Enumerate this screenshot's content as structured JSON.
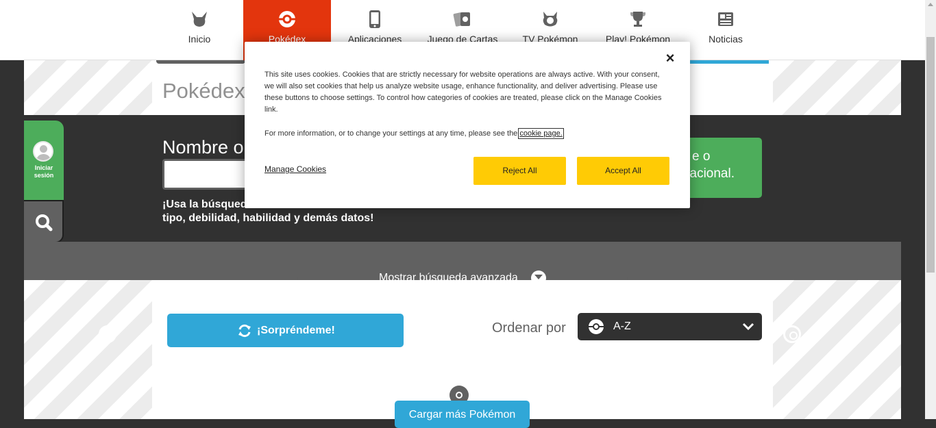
{
  "nav": {
    "items": [
      {
        "label": "Inicio",
        "icon": "pikachu-icon"
      },
      {
        "label": "Pokédex",
        "icon": "pokeball-icon"
      },
      {
        "label": "Aplicaciones",
        "icon": "phone-icon"
      },
      {
        "label": "Juego de Cartas",
        "icon": "cards-icon"
      },
      {
        "label": "TV Pokémon",
        "icon": "tv-icon"
      },
      {
        "label": "Play! Pokémon",
        "icon": "trophy-icon"
      },
      {
        "label": "Noticias",
        "icon": "newspaper-icon"
      }
    ],
    "active_index": 1,
    "active_color": "#e3350d"
  },
  "page": {
    "title": "Pokédex"
  },
  "search": {
    "heading": "Nombre o",
    "help_line1": "¡Usa la búsqueda",
    "help_line2": "tipo, debilidad, habilidad y demás datos!",
    "green_line1": "e o",
    "green_line2": "x Nacional."
  },
  "sidebar": {
    "login_line1": "Iniciar",
    "login_line2": "sesión"
  },
  "advanced": {
    "label": "Mostrar búsqueda avanzada"
  },
  "results": {
    "surprise_label": "¡Sorpréndeme!",
    "sort_label": "Ordenar por",
    "sort_value": "A-Z",
    "load_more_label": "Cargar más Pokémon"
  },
  "cookie": {
    "text1": "This site uses cookies. Cookies that are strictly necessary for website operations are always active. With your consent, we will also set cookies that help us analyze website usage, enhance functionality, and deliver advertising. Please use these buttons to choose settings. To control how categories of cookies are treated, please click on the Manage Cookies link.",
    "text2": "For more information, or to change your settings at any time, please see the",
    "link": "cookie page.",
    "manage": "Manage Cookies",
    "reject": "Reject All",
    "accept": "Accept All",
    "close": "×",
    "button_color": "#ffcb05"
  },
  "colors": {
    "blue": "#30a7d7",
    "green": "#4dad5b",
    "dark": "#313131",
    "gray": "#616161"
  }
}
